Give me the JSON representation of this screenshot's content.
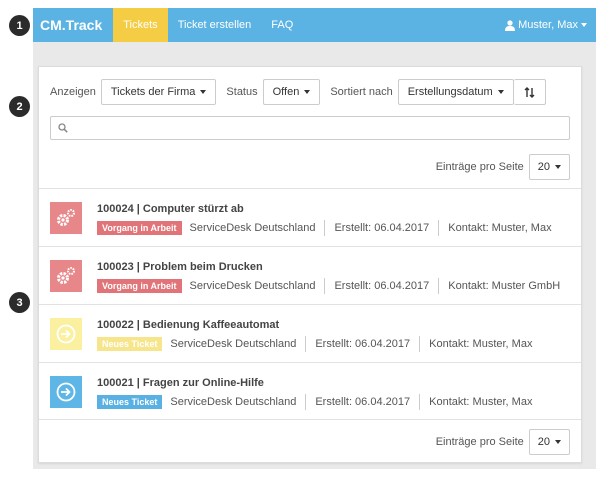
{
  "callouts": [
    "1",
    "2",
    "3"
  ],
  "navbar": {
    "brand": "CM.Track",
    "links": [
      "Tickets",
      "Ticket erstellen",
      "FAQ"
    ],
    "user": "Muster, Max"
  },
  "filters": {
    "show_label": "Anzeigen",
    "show_value": "Tickets der Firma",
    "status_label": "Status",
    "status_value": "Offen",
    "sort_label": "Sortiert nach",
    "sort_value": "Erstellungsdatum",
    "search_placeholder": ""
  },
  "pagination": {
    "label": "Einträge pro Seite",
    "value": "20"
  },
  "tickets": [
    {
      "title": "100024 | Computer stürzt ab",
      "status": "Vorgang in Arbeit",
      "org": "ServiceDesk Deutschland",
      "created": "Erstellt: 06.04.2017",
      "contact": "Kontakt: Muster, Max",
      "icon": "gears-icon",
      "color": "#e8878a"
    },
    {
      "title": "100023 | Problem beim Drucken",
      "status": "Vorgang in Arbeit",
      "org": "ServiceDesk Deutschland",
      "created": "Erstellt: 06.04.2017",
      "contact": "Kontakt: Muster GmbH",
      "icon": "gears-icon",
      "color": "#e8878a"
    },
    {
      "title": "100022 | Bedienung Kaffeeautomat",
      "status": "Neues Ticket",
      "org": "ServiceDesk Deutschland",
      "created": "Erstellt: 06.04.2017",
      "contact": "Kontakt: Muster, Max",
      "icon": "circle-arrow-icon",
      "color": "#faf0a0"
    },
    {
      "title": "100021 | Fragen zur Online-Hilfe",
      "status": "Neues Ticket",
      "org": "ServiceDesk Deutschland",
      "created": "Erstellt: 06.04.2017",
      "contact": "Kontakt: Muster, Max",
      "icon": "circle-arrow-icon",
      "color": "#5eb6e6"
    }
  ],
  "colors": {
    "navbar": "#5bb3e3",
    "active_tab": "#f5cd45",
    "in_progress": "#e07478",
    "new_ticket_yellow": "#f7e58c",
    "new_ticket_blue": "#58b0e3"
  }
}
